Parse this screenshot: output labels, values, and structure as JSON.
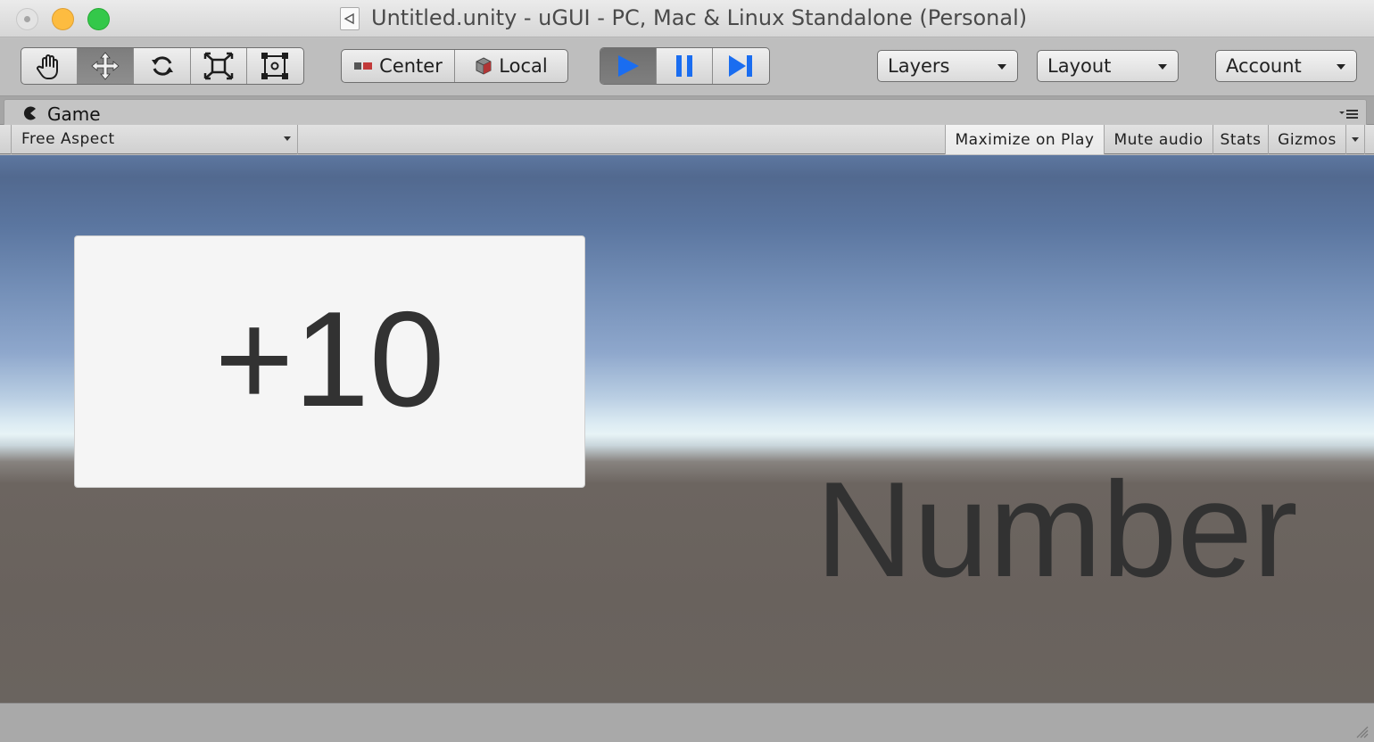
{
  "window": {
    "title": "Untitled.unity - uGUI - PC, Mac & Linux Standalone (Personal)"
  },
  "toolbar": {
    "tools": [
      {
        "name": "hand",
        "icon": "hand-icon",
        "active": false
      },
      {
        "name": "move",
        "icon": "move-icon",
        "active": true
      },
      {
        "name": "rotate",
        "icon": "rotate-icon",
        "active": false
      },
      {
        "name": "scale",
        "icon": "scale-icon",
        "active": false
      },
      {
        "name": "rect",
        "icon": "rect-tool-icon",
        "active": false
      }
    ],
    "pivot_mode": "Center",
    "pivot_rotation": "Local",
    "play_state": {
      "playing": true,
      "paused": false
    },
    "layers_label": "Layers",
    "layout_label": "Layout",
    "account_label": "Account"
  },
  "game_tab": {
    "label": "Game"
  },
  "game_toolbar": {
    "aspect": "Free Aspect",
    "maximize_on_play": "Maximize on Play",
    "mute_audio": "Mute audio",
    "stats": "Stats",
    "gizmos": "Gizmos",
    "maximize_on_play_enabled": true
  },
  "game_view": {
    "score_label": "+10",
    "number_label": "Number"
  },
  "colors": {
    "play_blue": "#1a6df0",
    "panel_bg": "#f5f5f5",
    "text_dark": "#323232"
  }
}
